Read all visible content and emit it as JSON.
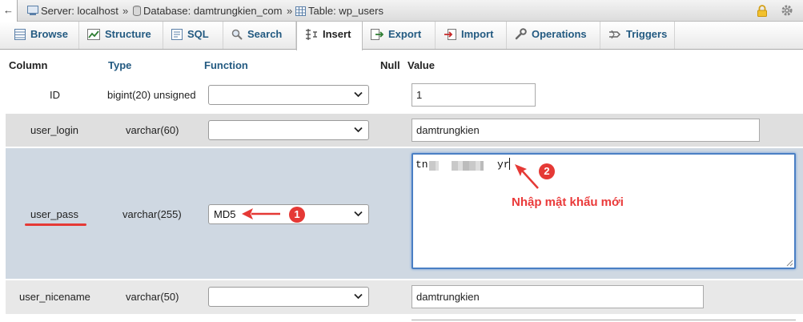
{
  "breadcrumb": {
    "back": "←",
    "server": "Server: localhost",
    "database": "Database: damtrungkien_com",
    "table": "Table: wp_users",
    "separator": "»"
  },
  "tabs": [
    {
      "label": "Browse",
      "icon": "browse-icon"
    },
    {
      "label": "Structure",
      "icon": "structure-icon"
    },
    {
      "label": "SQL",
      "icon": "sql-icon"
    },
    {
      "label": "Search",
      "icon": "search-icon"
    },
    {
      "label": "Insert",
      "icon": "insert-icon",
      "active": true
    },
    {
      "label": "Export",
      "icon": "export-icon"
    },
    {
      "label": "Import",
      "icon": "import-icon"
    },
    {
      "label": "Operations",
      "icon": "operations-icon"
    },
    {
      "label": "Triggers",
      "icon": "triggers-icon"
    }
  ],
  "columns": {
    "column": "Column",
    "type": "Type",
    "function": "Function",
    "null": "Null",
    "value": "Value"
  },
  "rows": [
    {
      "column": "ID",
      "type": "bigint(20) unsigned",
      "function": "",
      "value": "1"
    },
    {
      "column": "user_login",
      "type": "varchar(60)",
      "function": "",
      "value": "damtrungkien"
    },
    {
      "column": "user_pass",
      "type": "varchar(255)",
      "function": "MD5",
      "value_start": "tn",
      "value_end": "yr"
    },
    {
      "column": "user_nicename",
      "type": "varchar(50)",
      "function": "",
      "value": "damtrungkien"
    }
  ],
  "annotations": {
    "badge1": "1",
    "badge2": "2",
    "note": "Nhập mật khẩu mới"
  },
  "colors": {
    "accent_red": "#e53935",
    "link_blue": "#235a81",
    "selected_row": "#cfd8e2"
  }
}
